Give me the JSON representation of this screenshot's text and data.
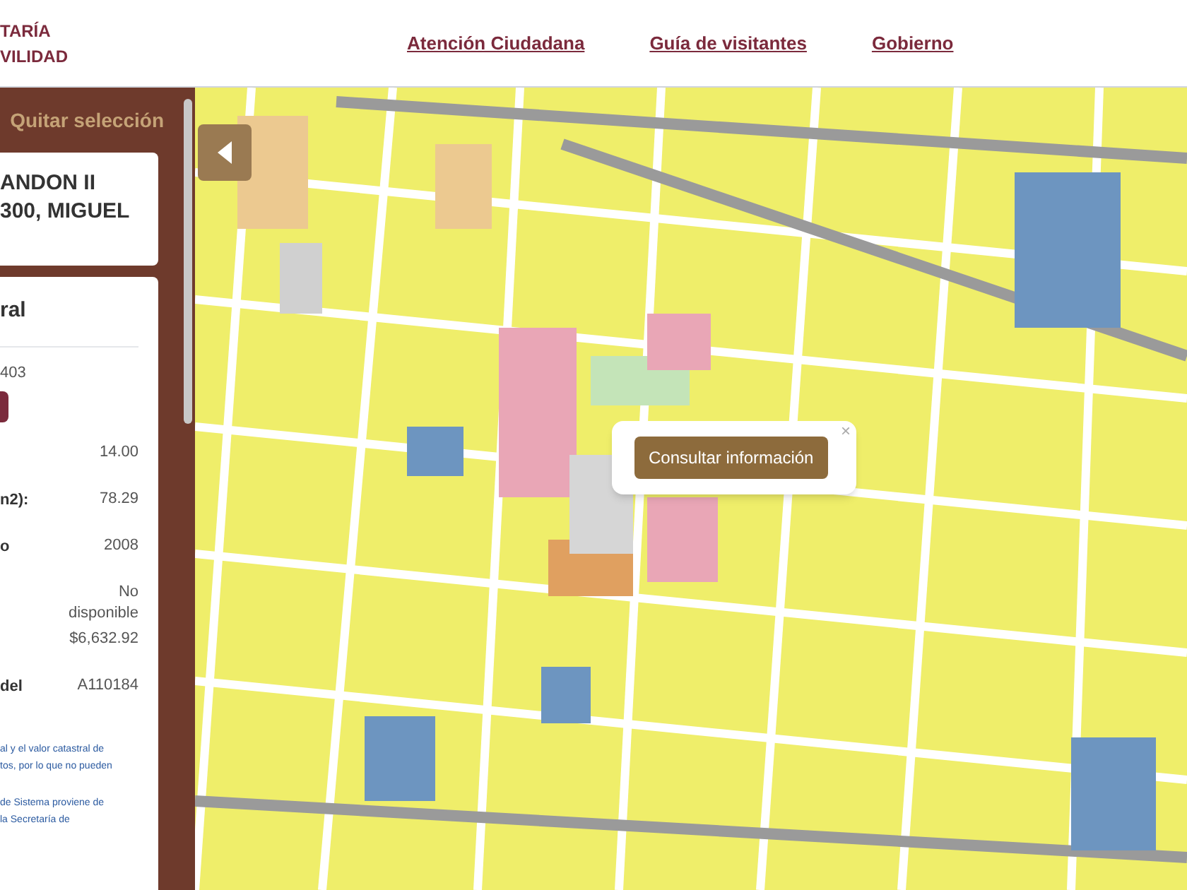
{
  "header": {
    "logo_lines": [
      "TARÍA",
      "VILIDAD"
    ],
    "nav": [
      {
        "label": "Atención Ciudadana"
      },
      {
        "label": "Guía de visitantes"
      },
      {
        "label": "Gobierno"
      }
    ]
  },
  "panel": {
    "clear_selection": "Quitar selección",
    "address_lines": [
      "ANDON II",
      "300, MIGUEL"
    ],
    "info": {
      "title": "ral",
      "account": "403",
      "rows": [
        {
          "label": "",
          "value": "14.00"
        },
        {
          "label": "n2):",
          "value": "78.29"
        },
        {
          "label": "o",
          "value": "2008"
        },
        {
          "label": "",
          "value": "No disponible"
        },
        {
          "label": "",
          "value": "$6,632.92"
        },
        {
          "label": "del",
          "value": "A110184"
        }
      ],
      "notes": [
        [
          "al y el valor catastral de",
          "tos, por lo que no pueden"
        ],
        [
          "de Sistema proviene de",
          "la Secretaría de"
        ]
      ]
    }
  },
  "map": {
    "popup": {
      "close": "×",
      "button": "Consultar información"
    }
  }
}
